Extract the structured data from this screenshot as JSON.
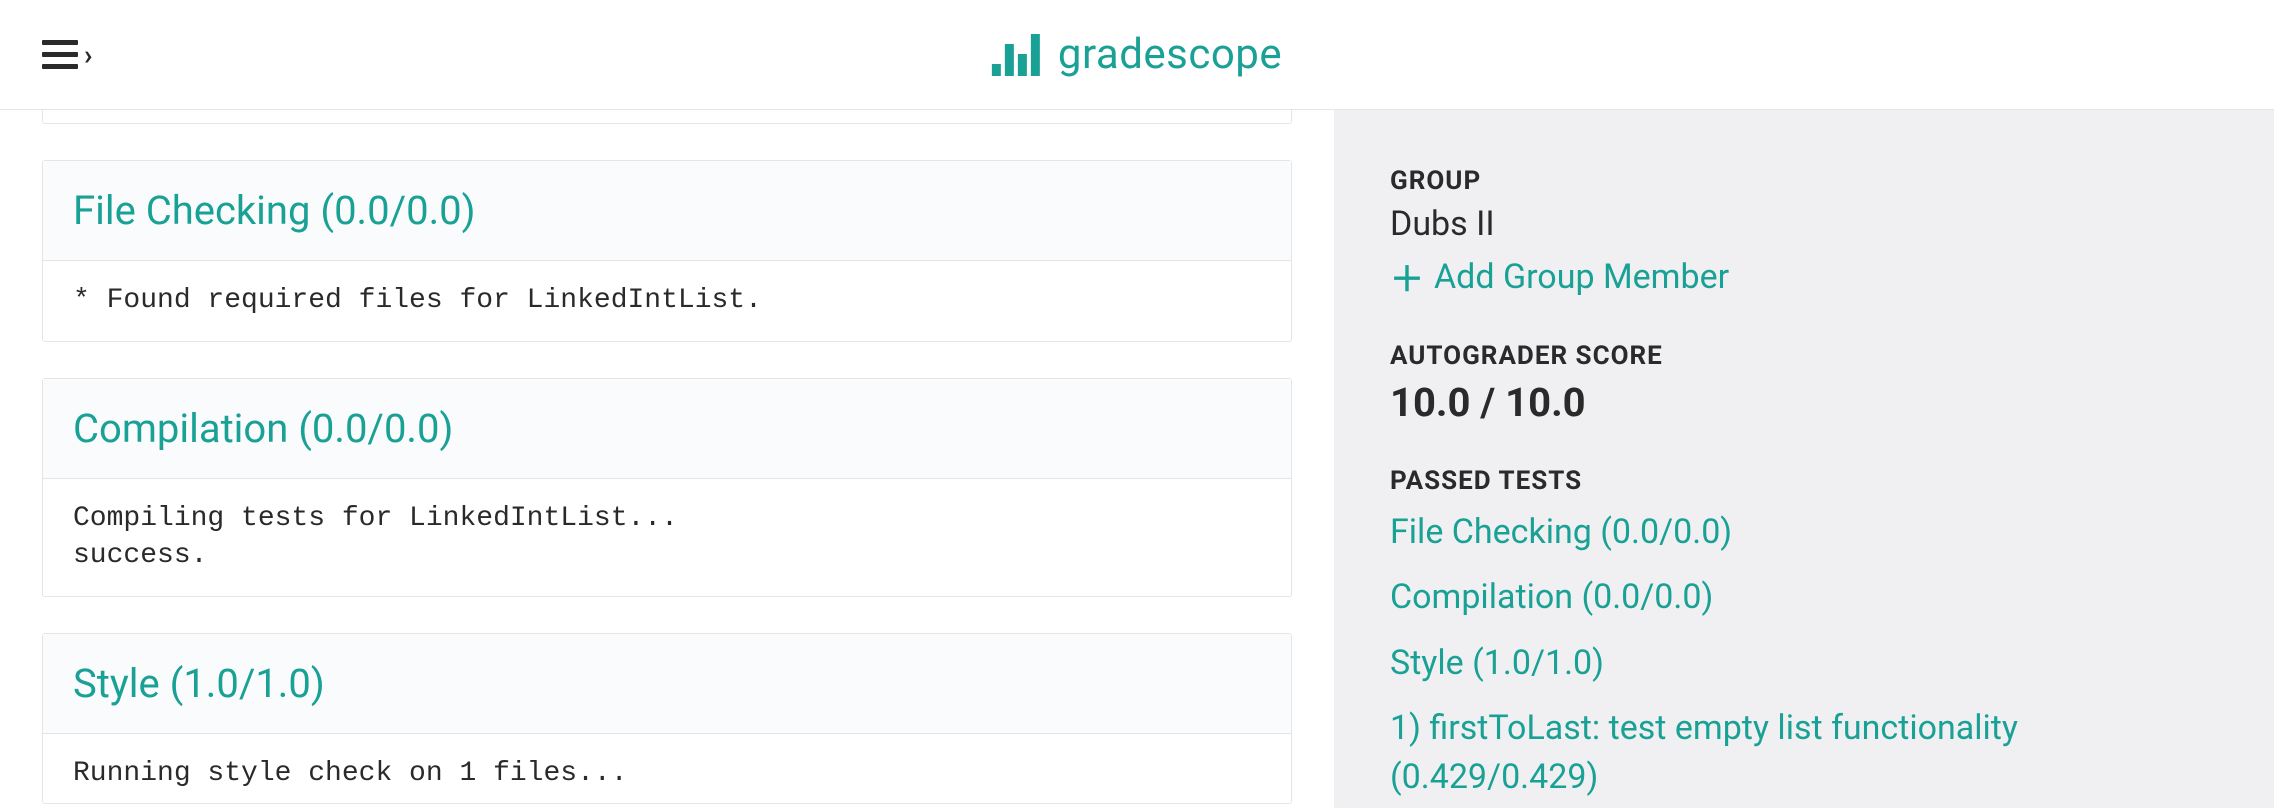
{
  "brand": {
    "name": "gradescope"
  },
  "tests": [
    {
      "title": "File Checking (0.0/0.0)",
      "body": "* Found required files for LinkedIntList."
    },
    {
      "title": "Compilation (0.0/0.0)",
      "body": "Compiling tests for LinkedIntList...\nsuccess."
    },
    {
      "title": "Style (1.0/1.0)",
      "body": "Running style check on 1 files..."
    }
  ],
  "sidebar": {
    "group_heading": "GROUP",
    "group_name": "Dubs II",
    "add_member_label": "Add Group Member",
    "autograder_heading": "AUTOGRADER SCORE",
    "autograder_score": "10.0 / 10.0",
    "passed_heading": "PASSED TESTS",
    "passed": [
      "File Checking (0.0/0.0)",
      "Compilation (0.0/0.0)",
      "Style (1.0/1.0)",
      "1) firstToLast: test empty list functionality (0.429/0.429)"
    ]
  }
}
